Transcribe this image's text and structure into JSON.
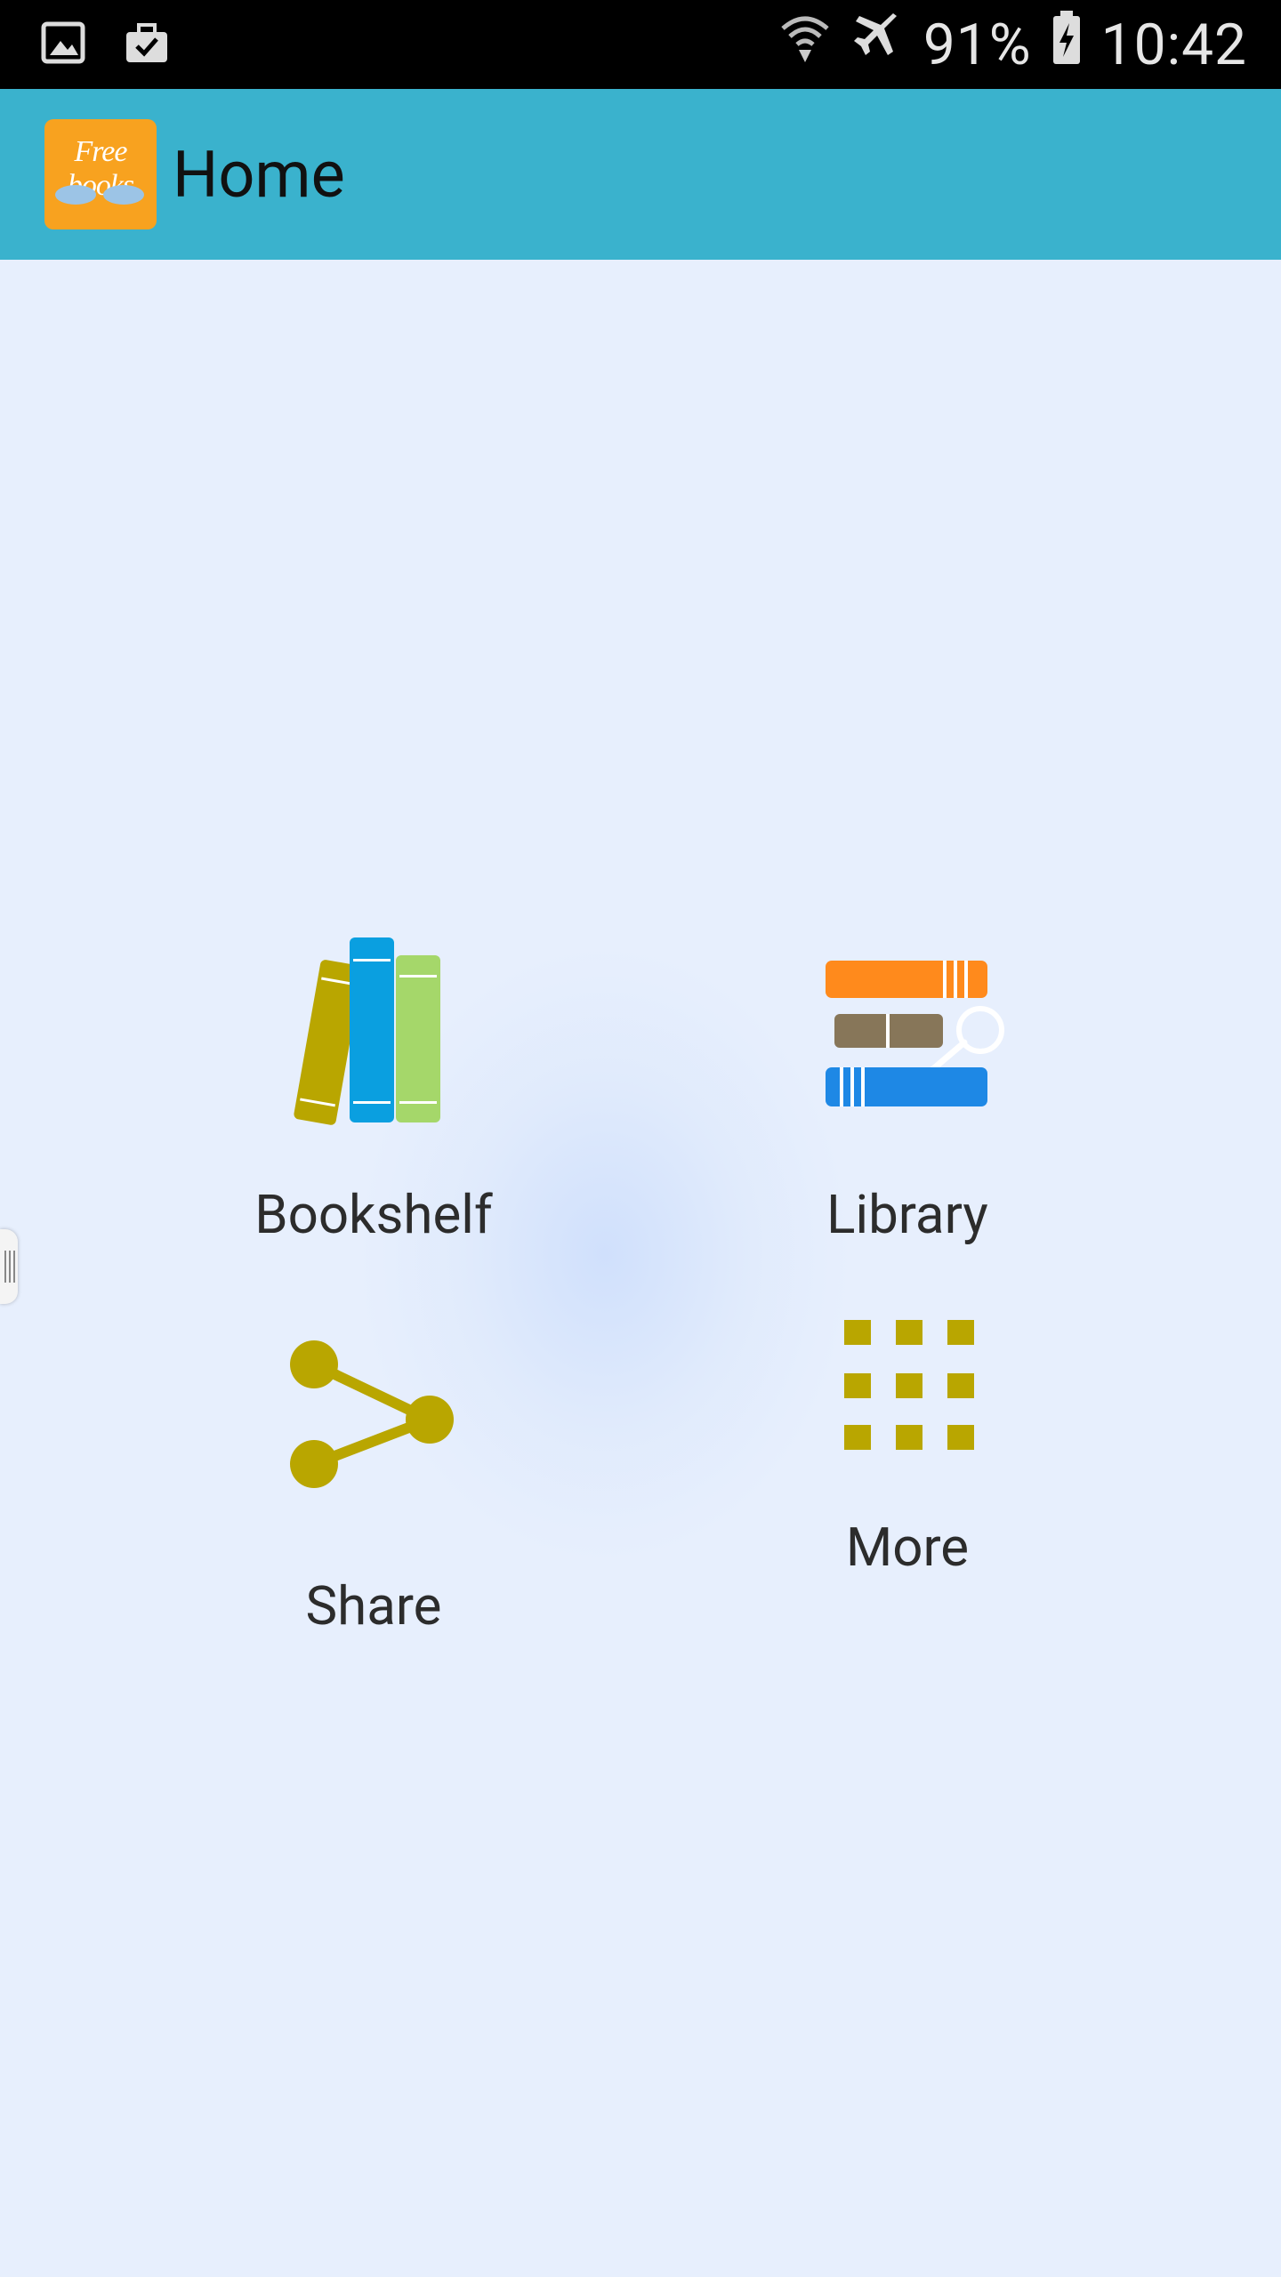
{
  "status_bar": {
    "battery": "91%",
    "time": "10:42",
    "icons_left": [
      "image-icon",
      "briefcase-check-icon"
    ],
    "icons_right": [
      "wifi-icon",
      "airplane-icon",
      "battery-charging-icon"
    ]
  },
  "app_bar": {
    "logo_text": "Free books",
    "title": "Home",
    "color": "#3ab2cd"
  },
  "menu": [
    {
      "label": "Bookshelf",
      "icon": "bookshelf-icon"
    },
    {
      "label": "Library",
      "icon": "library-search-icon"
    },
    {
      "label": "Share",
      "icon": "share-icon"
    },
    {
      "label": "More",
      "icon": "more-grid-icon"
    }
  ],
  "colors": {
    "background": "#e7effd",
    "accent_olive": "#b9a600",
    "orange": "#ff8a1c",
    "blue": "#0a9fe0"
  }
}
